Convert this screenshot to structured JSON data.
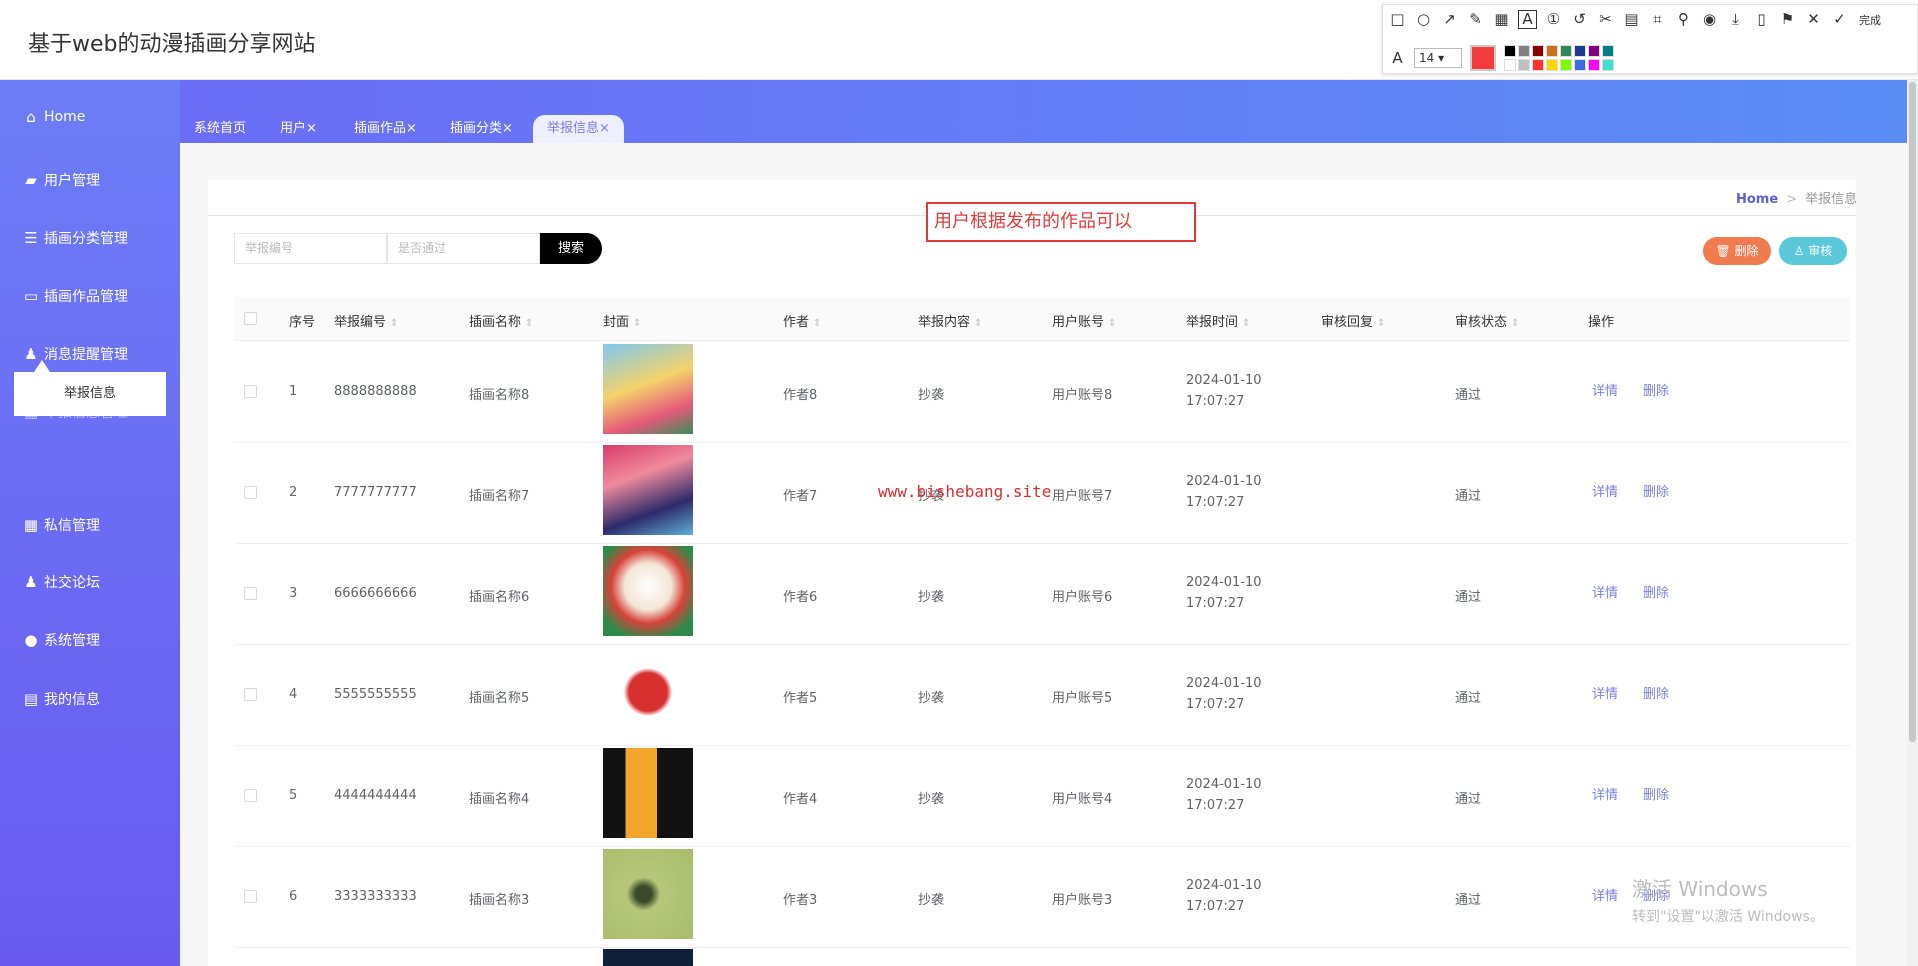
{
  "header": {
    "site_title": "基于web的动漫插画分享网站"
  },
  "snip_toolbar": {
    "icons": [
      "rectangle-icon",
      "ellipse-icon",
      "arrow-icon",
      "pen-icon",
      "mosaic-icon",
      "text-icon",
      "number-icon",
      "undo-icon",
      "scissors-icon",
      "ocr-icon",
      "crop-icon",
      "pin-icon",
      "record-icon",
      "download-icon",
      "save-icon",
      "bookmark-icon",
      "close-icon",
      "check-icon"
    ],
    "done_label": "完成",
    "font_size": "14",
    "current_color": "#f23c3c",
    "swatches": [
      "#000000",
      "#808080",
      "#8b0000",
      "#c87020",
      "#2e8b57",
      "#1e3a8a",
      "#800080",
      "#008080",
      "#ffffff",
      "#c0c0c0",
      "#ff3030",
      "#ffd700",
      "#7cfc00",
      "#4169e1",
      "#ff00ff",
      "#40e0d0"
    ]
  },
  "sidebar": {
    "items": [
      {
        "label": "Home",
        "icon": "home-icon"
      },
      {
        "label": "用户管理",
        "icon": "wallet-icon"
      },
      {
        "label": "插画分类管理",
        "icon": "list-icon"
      },
      {
        "label": "插画作品管理",
        "icon": "monitor-icon"
      },
      {
        "label": "消息提醒管理",
        "icon": "user-icon"
      },
      {
        "label": "举报信息管理",
        "icon": "grid-icon"
      },
      {
        "label": "私信管理",
        "icon": "grid-icon"
      },
      {
        "label": "社交论坛",
        "icon": "user-icon"
      },
      {
        "label": "系统管理",
        "icon": "bulb-icon"
      },
      {
        "label": "我的信息",
        "icon": "card-icon"
      }
    ],
    "sub_item": "举报信息"
  },
  "tabs": [
    {
      "label": "系统首页"
    },
    {
      "label": "用户×"
    },
    {
      "label": "插画作品×"
    },
    {
      "label": "插画分类×"
    },
    {
      "label": "举报信息×"
    }
  ],
  "breadcrumb": {
    "home": "Home",
    "sep": ">",
    "current": "举报信息"
  },
  "search": {
    "placeholder1": "举报编号",
    "placeholder2": "是否通过",
    "button": "搜索"
  },
  "actions": {
    "delete": "删除",
    "audit": "审核"
  },
  "annotation": "用户根据发布的作品可以",
  "table": {
    "headers": [
      "序号",
      "举报编号",
      "插画名称",
      "封面",
      "作者",
      "举报内容",
      "用户账号",
      "举报时间",
      "审核回复",
      "审核状态",
      "操作"
    ],
    "rows": [
      {
        "idx": "1",
        "code": "8888888888",
        "name": "插画名称8",
        "author": "作者8",
        "content": "抄袭",
        "account": "用户账号8",
        "time": "2024-01-10 17:07:27",
        "reply": "",
        "status": "通过"
      },
      {
        "idx": "2",
        "code": "7777777777",
        "name": "插画名称7",
        "author": "作者7",
        "content": "抄袭",
        "account": "用户账号7",
        "time": "2024-01-10 17:07:27",
        "reply": "",
        "status": "通过"
      },
      {
        "idx": "3",
        "code": "6666666666",
        "name": "插画名称6",
        "author": "作者6",
        "content": "抄袭",
        "account": "用户账号6",
        "time": "2024-01-10 17:07:27",
        "reply": "",
        "status": "通过"
      },
      {
        "idx": "4",
        "code": "5555555555",
        "name": "插画名称5",
        "author": "作者5",
        "content": "抄袭",
        "account": "用户账号5",
        "time": "2024-01-10 17:07:27",
        "reply": "",
        "status": "通过"
      },
      {
        "idx": "5",
        "code": "4444444444",
        "name": "插画名称4",
        "author": "作者4",
        "content": "抄袭",
        "account": "用户账号4",
        "time": "2024-01-10 17:07:27",
        "reply": "",
        "status": "通过"
      },
      {
        "idx": "6",
        "code": "3333333333",
        "name": "插画名称3",
        "author": "作者3",
        "content": "抄袭",
        "account": "用户账号3",
        "time": "2024-01-10 17:07:27",
        "reply": "",
        "status": "通过"
      }
    ],
    "op_detail": "详情",
    "op_delete": "删除"
  },
  "watermark": "www.bishebang.site",
  "windows_activation": {
    "title": "激活 Windows",
    "hint": "转到\"设置\"以激活 Windows。"
  }
}
